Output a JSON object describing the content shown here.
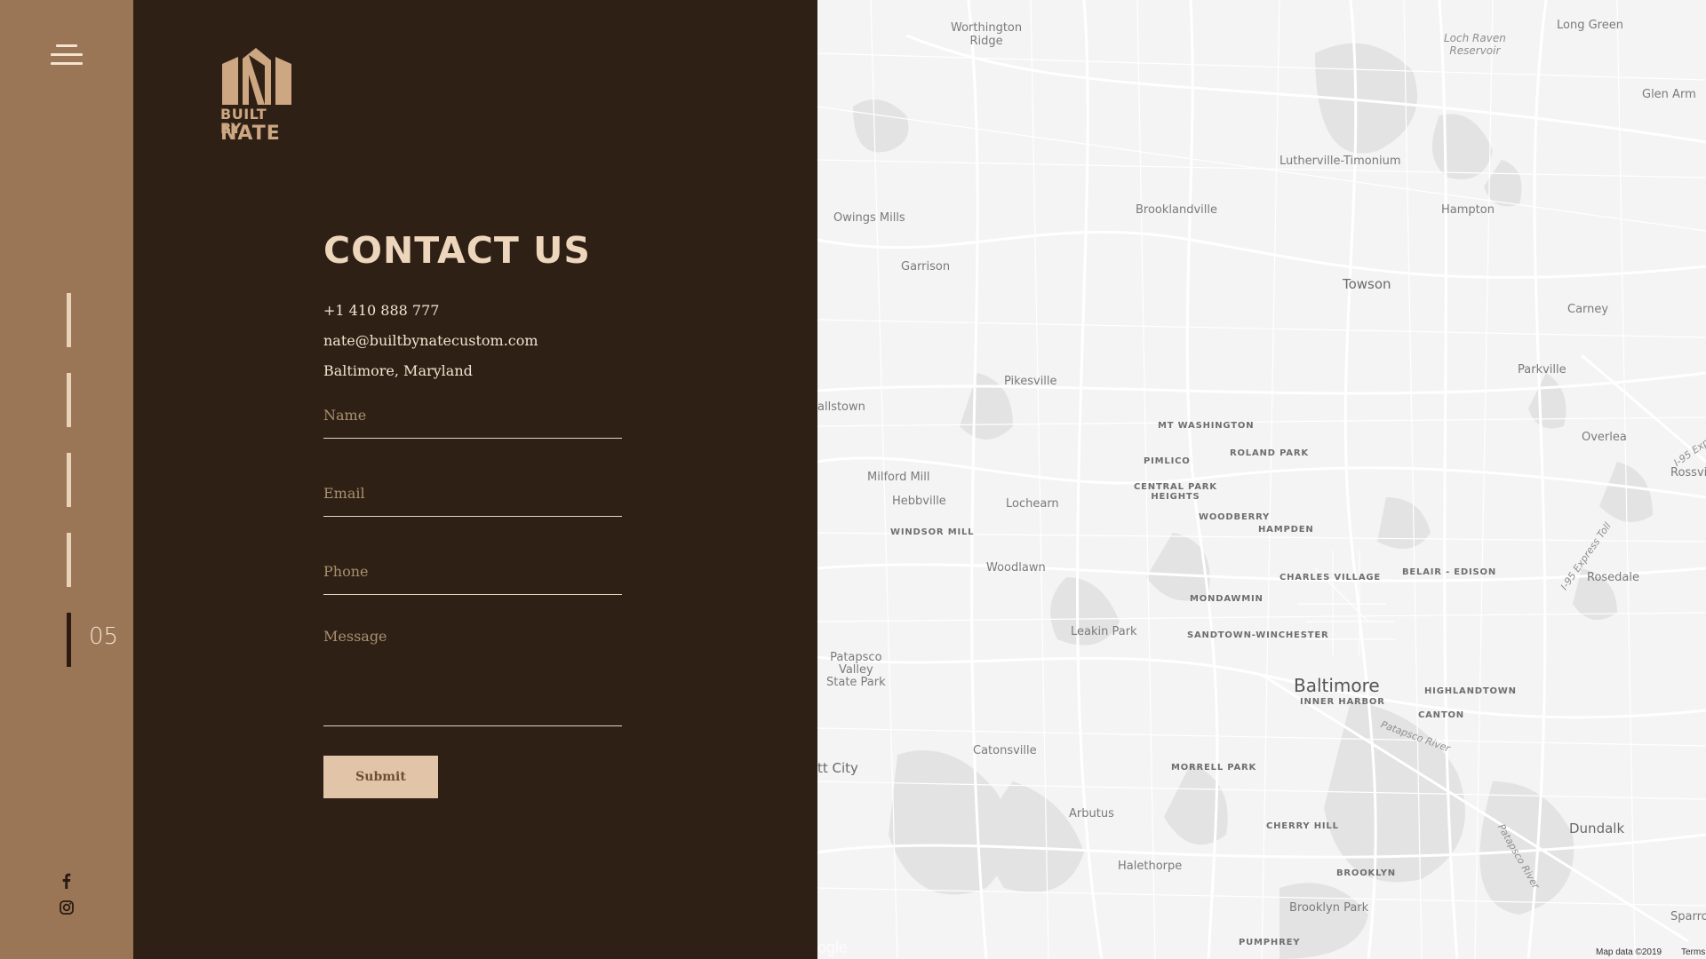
{
  "sidebar": {
    "step_number": "05",
    "social": [
      "facebook-icon",
      "instagram-icon"
    ]
  },
  "logo": {
    "line1": "BUILT BY",
    "line2": "NATE"
  },
  "contact": {
    "title": "CONTACT US",
    "phone": "+1 410 888 777",
    "email": "nate@builtbynatecustom.com",
    "location": "Baltimore, Maryland"
  },
  "form": {
    "name_placeholder": "Name",
    "email_placeholder": "Email",
    "phone_placeholder": "Phone",
    "message_placeholder": "Message",
    "submit_label": "Submit"
  },
  "map": {
    "places": {
      "worthington": "Worthington\nRidge",
      "loch_raven": "Loch Raven\nReservoir",
      "long_green": "Long Green",
      "glen_arm": "Glen Arm",
      "lutherville": "Lutherville-Timonium",
      "owings_mills": "Owings Mills",
      "brooklandville": "Brooklandville",
      "hampton": "Hampton",
      "garrison": "Garrison",
      "towson": "Towson",
      "carney": "Carney",
      "pikesville": "Pikesville",
      "parkville": "Parkville",
      "randallstown": "allstown",
      "mt_washington": "MT WASHINGTON",
      "overlea": "Overlea",
      "i95_express": "I-95 Expre",
      "pimlico": "PIMLICO",
      "roland_park": "ROLAND PARK",
      "rossville": "Rossvi",
      "milford_mill": "Milford Mill",
      "central_park_heights": "CENTRAL PARK\nHEIGHTS",
      "hebbville": "Hebbville",
      "lochearn": "Lochearn",
      "woodberry": "WOODBERRY",
      "windsor_mill": "WINDSOR MILL",
      "hampden": "HAMPDEN",
      "i95_express_toll": "I-95 Express Toll",
      "woodlawn": "Woodlawn",
      "charles_village": "CHARLES VILLAGE",
      "belair_edison": "BELAIR - EDISON",
      "rosedale": "Rosedale",
      "mondawmin": "MONDAWMIN",
      "leakin_park": "Leakin Park",
      "sandtown": "SANDTOWN-WINCHESTER",
      "patapsco_valley": "Patapsco\nValley\nState Park",
      "baltimore": "Baltimore",
      "inner_harbor": "INNER HARBOR",
      "highlandtown": "HIGHLANDTOWN",
      "canton": "CANTON",
      "patapsco_river": "Patapsco River",
      "ellicott_city": "tt City",
      "catonsville": "Catonsville",
      "morrell_park": "MORRELL PARK",
      "arbutus": "Arbutus",
      "cherry_hill": "CHERRY HILL",
      "dundalk": "Dundalk",
      "patapsco_river_2": "Patapsco River",
      "halethorpe": "Halethorpe",
      "brooklyn": "BROOKLYN",
      "brooklyn_park": "Brooklyn Park",
      "sparrows": "Sparrov",
      "pumphrey": "PUMPHREY"
    },
    "google": "ogle",
    "map_data": "Map data ©2019",
    "terms": "Terms"
  }
}
